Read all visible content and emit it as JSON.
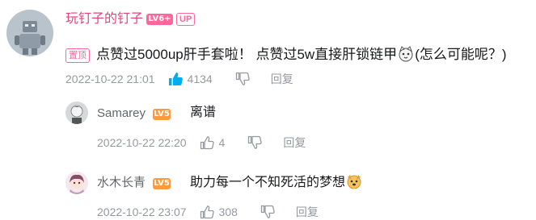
{
  "main_comment": {
    "username": "玩钉子的钉子",
    "level": "LV6+",
    "up_badge": "UP",
    "pin_badge": "置顶",
    "content_before_emoji": "点赞过5000up肝手套啦！ 点赞过5w直接肝锁链甲",
    "content_after_emoji": "(怎么可能呢？)",
    "time": "2022-10-22 21:01",
    "likes": "4134",
    "reply_label": "回复"
  },
  "replies": [
    {
      "username": "Samarey",
      "level": "LV5",
      "content": "离谱",
      "time": "2022-10-22 22:20",
      "likes": "4",
      "reply_label": "回复"
    },
    {
      "username": "水木长青",
      "level": "LV5",
      "content": "助力每一个不知死活的梦想",
      "time": "2022-10-22 23:07",
      "likes": "308",
      "reply_label": "回复"
    }
  ],
  "colors": {
    "accent_pink": "#ff6699",
    "liked_blue": "#00aeec",
    "meta_gray": "#9499a0"
  }
}
